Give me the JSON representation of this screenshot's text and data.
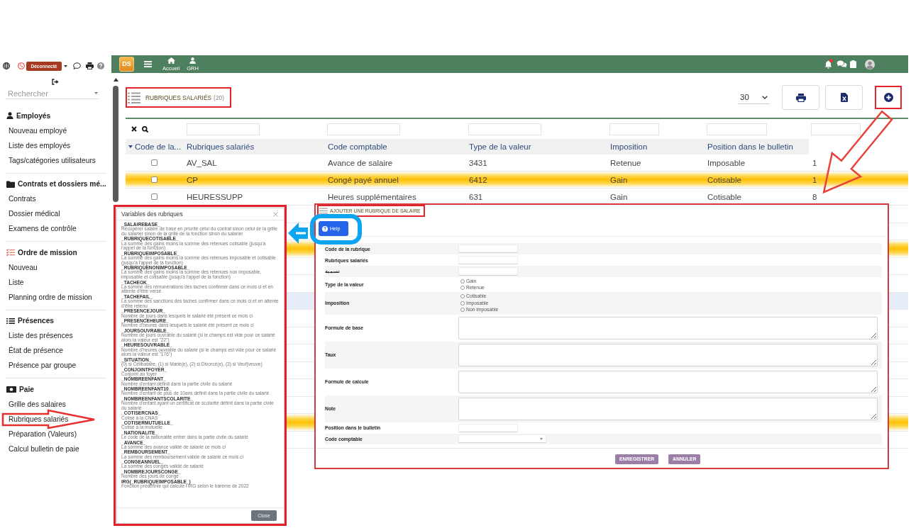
{
  "sidebar": {
    "status_badge": "Déconnecté",
    "search": {
      "placeholder": "Rechercher"
    },
    "sections": [
      {
        "title": "Employés",
        "items": [
          "Nouveau employé",
          "Liste des employés",
          "Tags/catégories utilisateurs"
        ]
      },
      {
        "title": "Contrats et dossiers mé...",
        "items": [
          "Contrats",
          "Dossier médical",
          "Examens de contrôle"
        ]
      },
      {
        "title": "Ordre de mission",
        "items": [
          "Nouveau",
          "Liste",
          "Planning ordre de mission"
        ]
      },
      {
        "title": "Présences",
        "items": [
          "Liste des présences",
          "État de présence",
          "Présence par groupe"
        ]
      },
      {
        "title": "Paie",
        "items": [
          "Grille des salaires",
          "Rubriques salariés",
          "Préparation (Valeurs)",
          "Calcul bulletin de paie"
        ]
      }
    ]
  },
  "topbar": {
    "logo": "DS",
    "nav": [
      {
        "label": "Accueil"
      },
      {
        "label": "GRH"
      }
    ],
    "has_notification": true
  },
  "table": {
    "title": "RUBRIQUES SALARIÉS",
    "count": "(20)",
    "page_size": "30",
    "columns": [
      {
        "label": "Code de la...",
        "sorted": true
      },
      {
        "label": "Rubriques salariés",
        "sorted": false
      },
      {
        "label": "Code comptable",
        "sorted": false
      },
      {
        "label": "Type de la valeur",
        "sorted": false
      },
      {
        "label": "Imposition",
        "sorted": false
      },
      {
        "label": "Position dans le bulletin",
        "sorted": false
      }
    ],
    "rows": [
      {
        "checked": false,
        "highlighted": false,
        "selected": false,
        "cells": [
          "",
          "AV_SAL",
          "Avance de salaire",
          "3431",
          "Retenue",
          "Imposable",
          "1"
        ]
      },
      {
        "checked": false,
        "highlighted": true,
        "selected": false,
        "cells": [
          "",
          "CP",
          "Congé payé annuel",
          "6412",
          "Gain",
          "Cotisable",
          "1"
        ]
      },
      {
        "checked": false,
        "highlighted": false,
        "selected": false,
        "cells": [
          "",
          "HEURESSUPP",
          "Heures supplémentaires",
          "631",
          "Gain",
          "Cotisable",
          "8"
        ]
      }
    ],
    "covered_rows": [
      {
        "highlighted": false,
        "selected": false
      },
      {
        "highlighted": false,
        "selected": false
      },
      {
        "highlighted": true,
        "selected": false
      },
      {
        "highlighted": false,
        "selected": false
      },
      {
        "highlighted": false,
        "selected": false
      },
      {
        "highlighted": false,
        "selected": true
      },
      {
        "highlighted": false,
        "selected": false
      },
      {
        "highlighted": false,
        "selected": false
      },
      {
        "highlighted": false,
        "selected": false
      },
      {
        "highlighted": false,
        "selected": false
      },
      {
        "highlighted": false,
        "selected": false
      },
      {
        "highlighted": false,
        "selected": false
      },
      {
        "highlighted": true,
        "selected": false
      },
      {
        "highlighted": false,
        "selected": false
      }
    ]
  },
  "variables_dialog": {
    "title": "Variables des rubriques",
    "close_label": "Close",
    "variables": [
      {
        "name": "_SALAIREBASE_",
        "description": "Récupérer salaire de base en priorité celui du contrat sinon celui de la grille du salarier sinon de la grille de la fonction sinon du salarier"
      },
      {
        "name": "_RUBRIQUECOTISABLE_",
        "description": "La somme des gains moins la somme des retenues cotisable (jusqu'à l'appel de la fonction)"
      },
      {
        "name": "_RUBRIQUEIMPOSABLE_",
        "description": "La somme des gains moins la somme des retenues imposable et cotisable (jusqu'à l'appel de la fonction)"
      },
      {
        "name": "_RUBRIQUENONIMPOSABLE_",
        "description": "La somme des gains moins la somme des retenues non imposable, imposable et cotisable (jusqu'à l'appel de la fonction)"
      },
      {
        "name": "_TACHEOK_",
        "description": "La somme des rémunérations des taches confirmer dans ce mois ci et en attente d'être versé"
      },
      {
        "name": "_TACHEFAIL_",
        "description": "La somme des sanctions des taches confirmer dans ce mois ci et en attente d'être retenu"
      },
      {
        "name": "_PRESENCEJOUR_",
        "description": "Nombre de jours dans lesquels le salarié été présent ce mois ci"
      },
      {
        "name": "_PRESENCEHEURE_",
        "description": "Nombre d'heures dans lesquels le salarié été présent ce mois ci"
      },
      {
        "name": "_JOURSOUVRABLE_",
        "description": "Nombre de jours ouvrable du salarié (si le champs est vide pour ce salarié alors la valeur est \"22\")"
      },
      {
        "name": "_HEURESOUVRABLE_",
        "description": "Nombre d'heures ouvrable du salarié (si le champs est vide pour ce salarié alors la valeur est \"176\")"
      },
      {
        "name": "_SITUATION_",
        "description": "(0) si Célibataire, (1) si Marié(e), (2) si Divorcé(e), (3) si Veuf(veuve)"
      },
      {
        "name": "_CONJOINTFOYER_",
        "description": "Conjoint au foyer"
      },
      {
        "name": "_NOMBREENFANT_",
        "description": "Nombre d'enfant définit dans la partie civile du salarié"
      },
      {
        "name": "_NOMBREENFANT10_",
        "description": "Nombre d'enfant de plus de 10ans définit dans la partie civile du salarié"
      },
      {
        "name": "_NOMBREENFANTSCOLARITE_",
        "description": "Nombre d'enfant ayant un certificat de scolarité définit dans la partie civile du salarié"
      },
      {
        "name": "_COTISERCNAS_",
        "description": "Cotisé à la CNAS"
      },
      {
        "name": "_COTISERMUTUELLE_",
        "description": "Cotisé à la mutuelle"
      },
      {
        "name": "_NATIONALITE_",
        "description": "Le code de la nationalité entrer dans la partie civile du salarié"
      },
      {
        "name": "_AVANCE_",
        "description": "La somme des avance validé de salarié ce mois ci"
      },
      {
        "name": "_REMBOURSEMENT_",
        "description": "La somme des remboursement validé de salarié ce mois ci"
      },
      {
        "name": "_CONGEANNUEL_",
        "description": "La somme des congés validé de salarié"
      },
      {
        "name": "_NOMBREJOURSCONGE_",
        "description": "Nombre des jours de congé"
      },
      {
        "name": "IRG(_RUBRIQUEIMPOSABLE_)",
        "description": "Fonction prédéfinie qui calcule l'IRG selon le barème de 2022"
      }
    ]
  },
  "add_form": {
    "title": "AJOUTER UNE RUBRIQUE DE SALAIRE",
    "help_label": "Help",
    "fields": [
      {
        "label": "Code de la rubrique",
        "kind": "text"
      },
      {
        "label": "Rubriques salariés",
        "kind": "text"
      },
      {
        "label": "تسمية",
        "kind": "text"
      },
      {
        "label": "Type de la valeur",
        "kind": "radio",
        "options": [
          {
            "label": "Gain",
            "selected": false
          },
          {
            "label": "Retenue",
            "selected": false
          }
        ]
      },
      {
        "label": "Imposition",
        "kind": "radio",
        "options": [
          {
            "label": "Cotisable",
            "selected": false
          },
          {
            "label": "Imposable",
            "selected": false
          },
          {
            "label": "Non imposable",
            "selected": false
          }
        ]
      },
      {
        "label": "Formule de base",
        "kind": "textarea"
      },
      {
        "label": "Taux",
        "kind": "textarea"
      },
      {
        "label": "Formule de calcule",
        "kind": "textarea"
      },
      {
        "label": "Note",
        "kind": "textarea"
      },
      {
        "label": "Position dans le bulletin",
        "kind": "text"
      },
      {
        "label": "Code comptable",
        "kind": "select"
      }
    ],
    "buttons": [
      "ENREGISTRER",
      "ANNULER"
    ]
  }
}
